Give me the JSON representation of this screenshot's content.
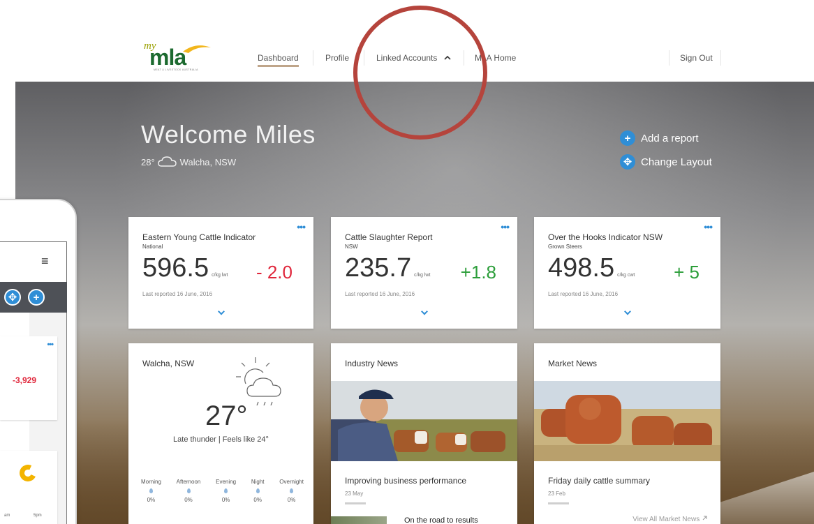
{
  "nav": {
    "logo_my": "my",
    "logo_mla": "mla",
    "logo_tagline": "MEAT & LIVESTOCK AUSTRALIA",
    "items": [
      {
        "label": "Dashboard"
      },
      {
        "label": "Profile"
      },
      {
        "label": "Linked Accounts"
      },
      {
        "label": "MLA Home"
      }
    ],
    "linked_accounts_chevron": "^",
    "sign_out": "Sign Out"
  },
  "hero": {
    "welcome": "Welcome Miles",
    "temperature": "28°",
    "location": "Walcha, NSW"
  },
  "actions": {
    "add_report": "Add a report",
    "change_layout": "Change Layout"
  },
  "indicators": [
    {
      "title": "Eastern Young Cattle Indicator",
      "sub": "National",
      "value": "596.5",
      "unit": "c/kg lwt",
      "delta": "- 2.0",
      "reported": "Last reported 16 June, 2016"
    },
    {
      "title": "Cattle Slaughter Report",
      "sub": "NSW",
      "value": "235.7",
      "unit": "c/kg lwt",
      "delta": "+1.8",
      "reported": "Last reported 16 June, 2016"
    },
    {
      "title": "Over the Hooks Indicator NSW",
      "sub": "Grown Steers",
      "value": "498.5",
      "unit": "c/kg cwt",
      "delta": "+ 5",
      "reported": "Last reported 16 June, 2016"
    }
  ],
  "weather": {
    "location": "Walcha, NSW",
    "temp": "27°",
    "desc": "Late thunder  |  Feels like 24°",
    "periods": [
      {
        "name": "Morning",
        "pct": "0%"
      },
      {
        "name": "Afternoon",
        "pct": "0%"
      },
      {
        "name": "Evening",
        "pct": "0%"
      },
      {
        "name": "Night",
        "pct": "0%"
      },
      {
        "name": "Overnight",
        "pct": "0%"
      }
    ]
  },
  "industry_news": {
    "title": "Industry News",
    "headline": "Improving business performance",
    "date": "23 May",
    "second": "On the road to results"
  },
  "market_news": {
    "title": "Market News",
    "headline": "Friday daily cattle summary",
    "date": "23 Feb",
    "view_all": "View All Market News"
  },
  "phone": {
    "value": "-3,929",
    "time1": "am",
    "time2": "5pm"
  },
  "colors": {
    "accent_blue": "#2f8ed6",
    "negative": "#e0273c",
    "positive": "#2c9e3a",
    "highlight_ring": "#b5443c",
    "logo_green": "#1c6a2f"
  }
}
